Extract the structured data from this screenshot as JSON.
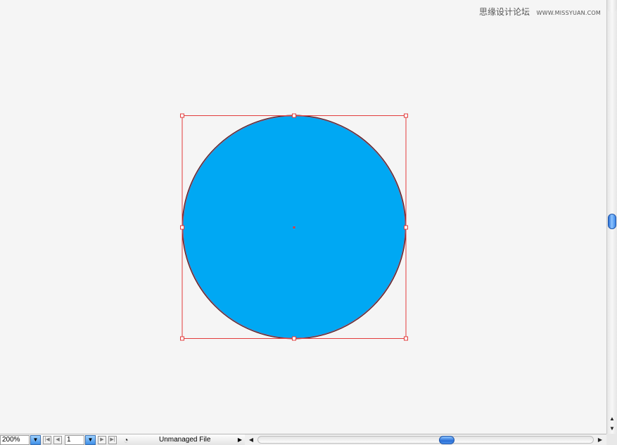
{
  "watermark": {
    "text_cn": "思缘设计论坛",
    "url": "WWW.MISSYUAN.COM"
  },
  "artboard": {
    "shape": "circle",
    "fill_color": "#00a8f3",
    "stroke_color": "#5a1010",
    "selection_color": "#e23b3b"
  },
  "statusbar": {
    "zoom_value": "200%",
    "page_value": "1",
    "status_text": "Unmanaged File"
  },
  "icons": {
    "zoom_dropdown": "chevron-down-icon",
    "first_page": "first-page-icon",
    "prev_page": "previous-page-icon",
    "page_dropdown": "chevron-down-icon",
    "next_page": "next-page-icon",
    "last_page": "last-page-icon",
    "status": "document-status-icon",
    "status_menu": "triangle-right-icon"
  },
  "colors": {
    "accent_blue": "#3d8fe8",
    "canvas_bg": "#f5f5f5"
  }
}
